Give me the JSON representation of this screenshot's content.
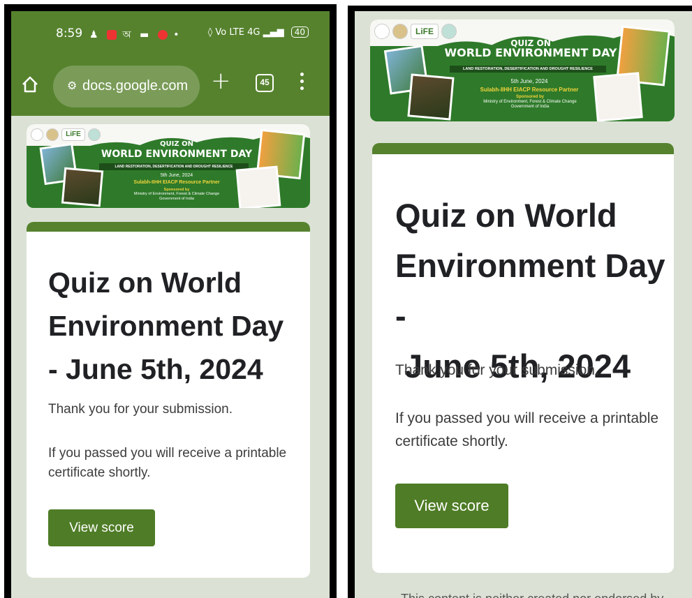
{
  "status_bar": {
    "time": "8:59",
    "network": "Vo LTE 4G",
    "battery": "40"
  },
  "browser": {
    "url": "docs.google.com",
    "tab_count": "45"
  },
  "banner": {
    "title_small": "QUIZ ON",
    "title_big": "WORLD ENVIRONMENT DAY",
    "subtitle": "LAND RESTORATION, DESERTIFICATION AND DROUGHT RESILIENCE",
    "date": "5th June, 2024",
    "partner": "Sulabh-IIHH EIACP Resource Partner",
    "sponsored_label": "Sponsored by",
    "sponsor_line1": "Ministry of Environment, Forest & Climate Change",
    "sponsor_line2": "Government of India",
    "life_logo": "LiFE"
  },
  "form": {
    "title_left": [
      "Quiz on World",
      "Environment Day",
      "- June 5th, 2024"
    ],
    "title_right": [
      "Quiz on World",
      "Environment Day -",
      " June 5th, 2024"
    ],
    "thanks": "Thank you for your submission.",
    "cert_left": [
      "If you passed you will receive a printable",
      "certificate shortly."
    ],
    "cert_right": [
      "If you passed you will receive a printable",
      "certificate shortly."
    ],
    "button": "View score",
    "footer_note": "This content is neither created nor endorsed by"
  },
  "colors": {
    "brand_green": "#56822e",
    "button_green": "#4f7c26",
    "page_bg": "#dbe2d5"
  }
}
